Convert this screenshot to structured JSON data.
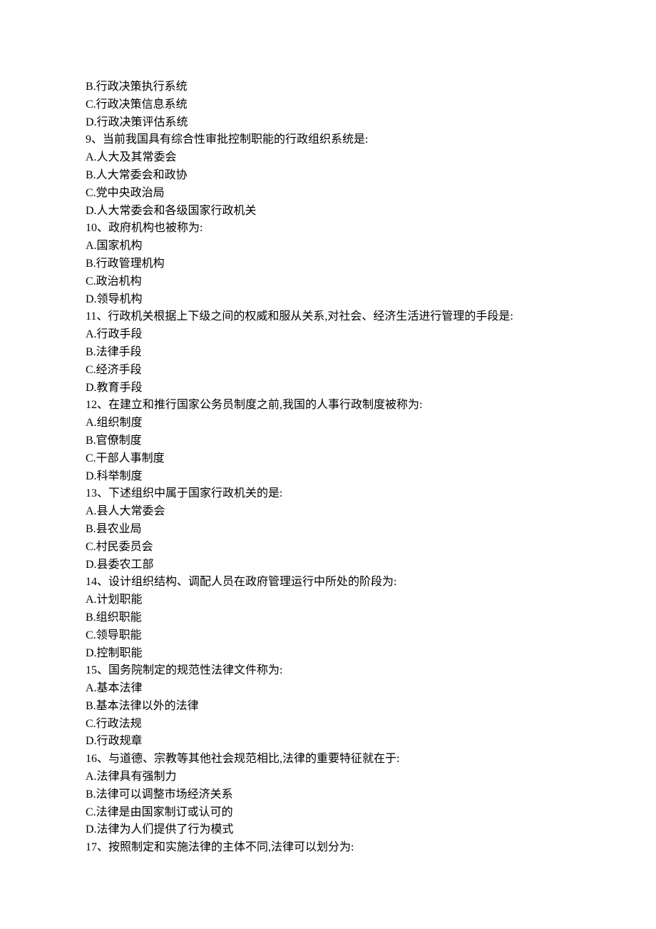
{
  "lines": [
    "B.行政决策执行系统",
    "C.行政决策信息系统",
    "D.行政决策评估系统",
    "9、当前我国具有综合性审批控制职能的行政组织系统是:",
    "A.人大及其常委会",
    "B.人大常委会和政协",
    "C.党中央政治局",
    "D.人大常委会和各级国家行政机关",
    "10、政府机构也被称为:",
    "A.国家机构",
    "B.行政管理机构",
    "C.政治机构",
    "D.领导机构",
    "11、行政机关根据上下级之间的权威和服从关系,对社会、经济生活进行管理的手段是:",
    "A.行政手段",
    "B.法律手段",
    "C.经济手段",
    "D.教育手段",
    "12、在建立和推行国家公务员制度之前,我国的人事行政制度被称为:",
    "A.组织制度",
    "B.官僚制度",
    "C.干部人事制度",
    "D.科举制度",
    "13、下述组织中属于国家行政机关的是:",
    "A.县人大常委会",
    "B.县农业局",
    "C.村民委员会",
    "D.县委农工部",
    "14、设计组织结构、调配人员在政府管理运行中所处的阶段为:",
    "A.计划职能",
    "B.组织职能",
    "C.领导职能",
    "D.控制职能",
    "15、国务院制定的规范性法律文件称为:",
    "A.基本法律",
    "B.基本法律以外的法律",
    "C.行政法规",
    "D.行政规章",
    "16、与道德、宗教等其他社会规范相比,法律的重要特征就在于:",
    "A.法律具有强制力",
    "B.法律可以调整市场经济关系",
    "C.法律是由国家制订或认可的",
    "D.法律为人们提供了行为模式",
    "17、按照制定和实施法律的主体不同,法律可以划分为:"
  ]
}
